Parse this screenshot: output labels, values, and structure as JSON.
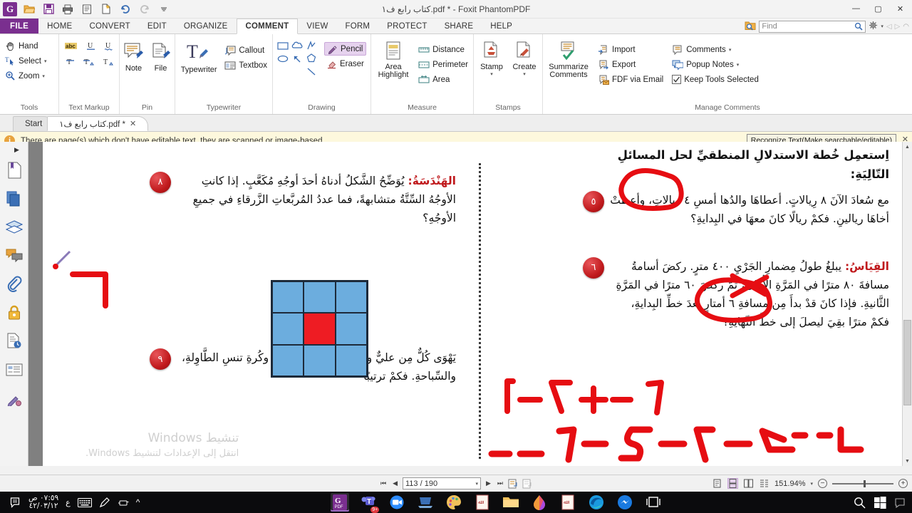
{
  "window": {
    "title": "كتاب رابع ف١.pdf * - Foxit PhantomPDF",
    "quick_access": [
      "app-logo",
      "open-icon",
      "save-icon",
      "print-icon",
      "properties-icon",
      "new-icon",
      "undo-icon",
      "redo-icon",
      "customize-caret"
    ],
    "minimize": "—",
    "maximize": "▢",
    "close": "✕"
  },
  "ribbon_tabs": [
    {
      "label": "FILE",
      "active": false
    },
    {
      "label": "HOME",
      "active": false
    },
    {
      "label": "CONVERT",
      "active": false
    },
    {
      "label": "EDIT",
      "active": false
    },
    {
      "label": "ORGANIZE",
      "active": false
    },
    {
      "label": "COMMENT",
      "active": true
    },
    {
      "label": "VIEW",
      "active": false
    },
    {
      "label": "FORM",
      "active": false
    },
    {
      "label": "PROTECT",
      "active": false
    },
    {
      "label": "SHARE",
      "active": false
    },
    {
      "label": "HELP",
      "active": false
    }
  ],
  "search": {
    "placeholder": "Find",
    "value": ""
  },
  "ribbon": {
    "groups": [
      {
        "name": "Tools",
        "items": [
          {
            "label": "Hand",
            "icon": "hand-icon",
            "caret": false
          },
          {
            "label": "Select",
            "icon": "select-text-icon",
            "caret": true
          },
          {
            "label": "Zoom",
            "icon": "zoom-icon",
            "caret": true
          }
        ]
      },
      {
        "name": "Text Markup",
        "items": [
          {
            "label": "",
            "icon": "highlight-icon"
          },
          {
            "label": "",
            "icon": "underline-icon"
          },
          {
            "label": "",
            "icon": "squiggly-underline-icon"
          },
          {
            "label": "",
            "icon": "strikeout-icon"
          },
          {
            "label": "",
            "icon": "replace-text-icon"
          },
          {
            "label": "",
            "icon": "insert-text-icon"
          }
        ]
      },
      {
        "name": "Pin",
        "items": [
          {
            "label": "Note",
            "icon": "note-pin-icon"
          },
          {
            "label": "File",
            "icon": "file-pin-icon"
          }
        ]
      },
      {
        "name": "Typewriter",
        "items": [
          {
            "label": "Typewriter",
            "icon": "typewriter-icon"
          },
          {
            "label": "Callout",
            "icon": "callout-icon"
          },
          {
            "label": "Textbox",
            "icon": "textbox-icon"
          }
        ]
      },
      {
        "name": "Drawing",
        "items": [
          {
            "label": "",
            "icon": "rectangle-icon"
          },
          {
            "label": "",
            "icon": "cloud-icon"
          },
          {
            "label": "",
            "icon": "polyline-icon"
          },
          {
            "label": "",
            "icon": "oval-icon"
          },
          {
            "label": "",
            "icon": "arrow-icon"
          },
          {
            "label": "",
            "icon": "polygon-icon"
          },
          {
            "label": "",
            "icon": "line-icon"
          },
          {
            "label": "Pencil",
            "icon": "pencil-icon",
            "selected": true
          },
          {
            "label": "Eraser",
            "icon": "eraser-icon",
            "selected": false
          }
        ]
      },
      {
        "name": "Measure",
        "items": [
          {
            "label": "Area Highlight",
            "icon": "area-highlight-icon"
          },
          {
            "label": "Distance",
            "icon": "distance-icon"
          },
          {
            "label": "Perimeter",
            "icon": "perimeter-icon"
          },
          {
            "label": "Area",
            "icon": "area-icon"
          }
        ]
      },
      {
        "name": "Stamps",
        "items": [
          {
            "label": "Stamp",
            "icon": "stamp-icon",
            "caret": true
          },
          {
            "label": "Create",
            "icon": "create-stamp-icon",
            "caret": true
          }
        ]
      },
      {
        "name": "Manage Comments",
        "items": [
          {
            "label": "Summarize Comments",
            "icon": "summarize-comments-icon"
          },
          {
            "label": "Import",
            "icon": "import-icon"
          },
          {
            "label": "Export",
            "icon": "export-icon"
          },
          {
            "label": "FDF via Email",
            "icon": "fdf-email-icon"
          },
          {
            "label": "Comments",
            "icon": "comments-icon",
            "caret": true
          },
          {
            "label": "Popup Notes",
            "icon": "popup-notes-icon",
            "caret": true
          },
          {
            "label": "Keep Tools Selected",
            "icon": "checkbox-checked-icon",
            "checked": true
          }
        ]
      }
    ]
  },
  "doc_tabs": [
    {
      "label": "Start",
      "active": false,
      "closable": false
    },
    {
      "label": "كتاب رابع ف١.pdf *",
      "active": true,
      "closable": true,
      "close": "✕"
    }
  ],
  "notification": {
    "icon": "info-icon",
    "message": "There are page(s) which don't have editable text, they are scanned or image-based.",
    "action_label": "Recognize Text(Make searchable/editable)",
    "close": "✕"
  },
  "nav_pane": {
    "expand": "▶",
    "items": [
      {
        "name": "bookmarks-icon"
      },
      {
        "name": "pages-thumbnails-icon"
      },
      {
        "name": "layers-icon"
      },
      {
        "name": "comments-panel-icon"
      },
      {
        "name": "attachments-icon"
      },
      {
        "name": "security-lock-icon"
      },
      {
        "name": "digital-signature-icon"
      },
      {
        "name": "fields-icon"
      },
      {
        "name": "stamps-panel-icon"
      }
    ]
  },
  "document": {
    "instruction": "اِستعمِل خُطة الاستدلالِ المنطقيِّ لحل المسائلِ التّالِيَةِ:",
    "right_column": [
      {
        "number": "٥",
        "subject": "",
        "text": "مع سُعادَ الآنَ ٨ رِيالاتٍ. أعطاهَا والدُها أمسِ ٤ ريالاتٍ، وأعطتْ أخاهَا ريالينِ. فكمْ ريالًا كانَ معهَا في البِدايةِ؟"
      },
      {
        "number": "٦",
        "subject": "القِيَاسُ:",
        "text": "يبلغُ طولُ مِضمارِ الجَرْيِ ٤٠٠ مترٍ. ركضَ أسامةُ مسافةَ ٨٠ مترًا في المَرَّةِ الأُولى، ثُمَّ ركضَ ٦٠ مترًا في المَرَّةِ الثَّانيةِ. فإذا كانَ قدْ بدأَ مِن مسافةِ ٦ أمتارٍ بعدَ خطِّ البِدايةِ، فكمْ مترًا بقِيَ ليصلَ إلى خطِّ النِّهايةِ؟"
      }
    ],
    "left_column": [
      {
        "number": "٨",
        "subject": "الهَنْدَسَةُ:",
        "text": "يُوَضِّحُ الشَّكلُ أدناهُ أحدَ أوجُهِ مُكَعَّبٍ. إذا كانتِ الأوجُهُ السِّتَّةُ متشابهةً، فما عددُ المُربَّعاتِ الزَّرقاءِ في جميعِ الأوجُهِ؟"
      },
      {
        "number": "٩",
        "subject": "",
        "text": "يَهْوَى كُلٌّ مِن عليٌّ وعمرَ لعبَ كُرةِ القدمِ، وكُرةِ تنسِ الطَّاوِلةِ، والسِّباحةِ. فكمْ ترتيبًا"
      }
    ],
    "figure": {
      "name": "cube-face-grid",
      "rows": 3,
      "cols": 3,
      "blue_color": "#6cadde",
      "red_color": "#ee1c23",
      "red_cell_index": 4
    },
    "ink_annotations": [
      {
        "name": "ink-circle-8-riyals"
      },
      {
        "name": "ink-equation-1",
        "text": "٨ - ٤ + ٢ = ٦"
      },
      {
        "name": "ink-circle-400-meters"
      },
      {
        "name": "ink-equation-2",
        "text": "٤٠٠ - ٦ - ٨٠ - ٦٠ = ٢٥٤"
      },
      {
        "name": "ink-mark-left-column"
      }
    ],
    "watermark": [
      "تنشيط Windows",
      "انتقل إلى الإعدادات لتنشيط Windows."
    ]
  },
  "status_bar": {
    "first_page": "⏮",
    "prev_page": "◀",
    "page_value": "113 / 190",
    "page_caret": "▾",
    "next_page": "▶",
    "last_page": "⏭",
    "fit_page_icon": "fit-page-icon",
    "fit_width_icon": "fit-width-icon",
    "view_modes": [
      {
        "name": "single-page-view",
        "active": false
      },
      {
        "name": "continuous-view",
        "active": true
      },
      {
        "name": "facing-view",
        "active": false
      },
      {
        "name": "facing-continuous-view",
        "active": false
      }
    ],
    "zoom_value": "151.94%",
    "zoom_caret": "▾",
    "zoom_out": "−",
    "zoom_in": "+"
  },
  "taskbar": {
    "clock_time": "٠٧:٥٩ ص",
    "clock_date": "٤٢/٠٣/١٢",
    "tray": [
      {
        "name": "notifications-icon"
      },
      {
        "name": "language-indicator",
        "label": "ع"
      },
      {
        "name": "touch-keyboard-icon"
      },
      {
        "name": "pen-icon"
      },
      {
        "name": "network-icon"
      },
      {
        "name": "show-hidden-icons-chevron",
        "label": "^"
      }
    ],
    "apps": [
      {
        "name": "foxit-phantompdf-taskbar",
        "label": "PDF",
        "active": true
      },
      {
        "name": "microsoft-teams-taskbar",
        "badge": "9+"
      },
      {
        "name": "zoom-taskbar"
      },
      {
        "name": "remote-desktop-taskbar"
      },
      {
        "name": "paint-taskbar"
      },
      {
        "name": "document-window-1-taskbar"
      },
      {
        "name": "file-explorer-taskbar"
      },
      {
        "name": "onedrive-paint3d-taskbar"
      },
      {
        "name": "document-window-2-taskbar"
      },
      {
        "name": "microsoft-edge-taskbar"
      },
      {
        "name": "messenger-taskbar"
      },
      {
        "name": "task-view-taskbar"
      }
    ],
    "search_icon": "search-icon",
    "start_icon": "windows-start-icon"
  }
}
